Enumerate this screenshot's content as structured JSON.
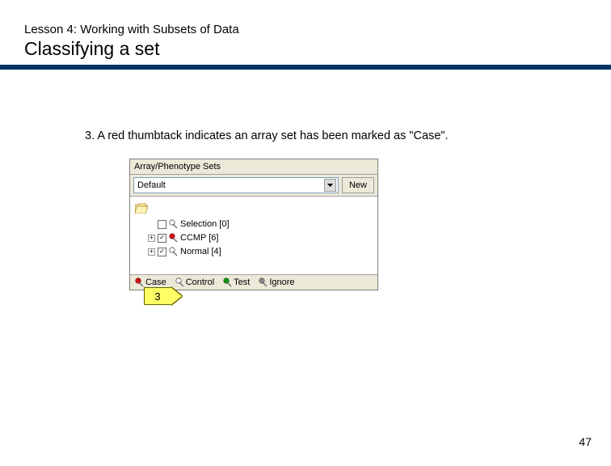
{
  "header": {
    "lesson": "Lesson 4: Working with Subsets of Data",
    "title": "Classifying a set"
  },
  "body": {
    "step_text": "3. A red thumbtack indicates an array set has been marked as \"Case\"."
  },
  "panel": {
    "title": "Array/Phenotype Sets",
    "dropdown_value": "Default",
    "new_button": "New",
    "tree": {
      "items": [
        {
          "expander": "",
          "checked": false,
          "pin": "white",
          "label": "Selection [0]"
        },
        {
          "expander": "+",
          "checked": true,
          "pin": "red",
          "label": "CCMP [6]"
        },
        {
          "expander": "+",
          "checked": true,
          "pin": "white",
          "label": "Normal [4]"
        }
      ]
    },
    "footer": [
      {
        "pin": "red",
        "label": "Case"
      },
      {
        "pin": "white",
        "label": "Control"
      },
      {
        "pin": "green",
        "label": "Test"
      },
      {
        "pin": "gray",
        "label": "Ignore"
      }
    ]
  },
  "callout": {
    "number": "3"
  },
  "page_number": "47",
  "colors": {
    "rule": "#003366",
    "callout_bg": "#ffff66",
    "pin_red": "#d41414",
    "pin_green": "#129b12",
    "pin_gray": "#8a8a8a",
    "pin_white": "#ffffff"
  }
}
